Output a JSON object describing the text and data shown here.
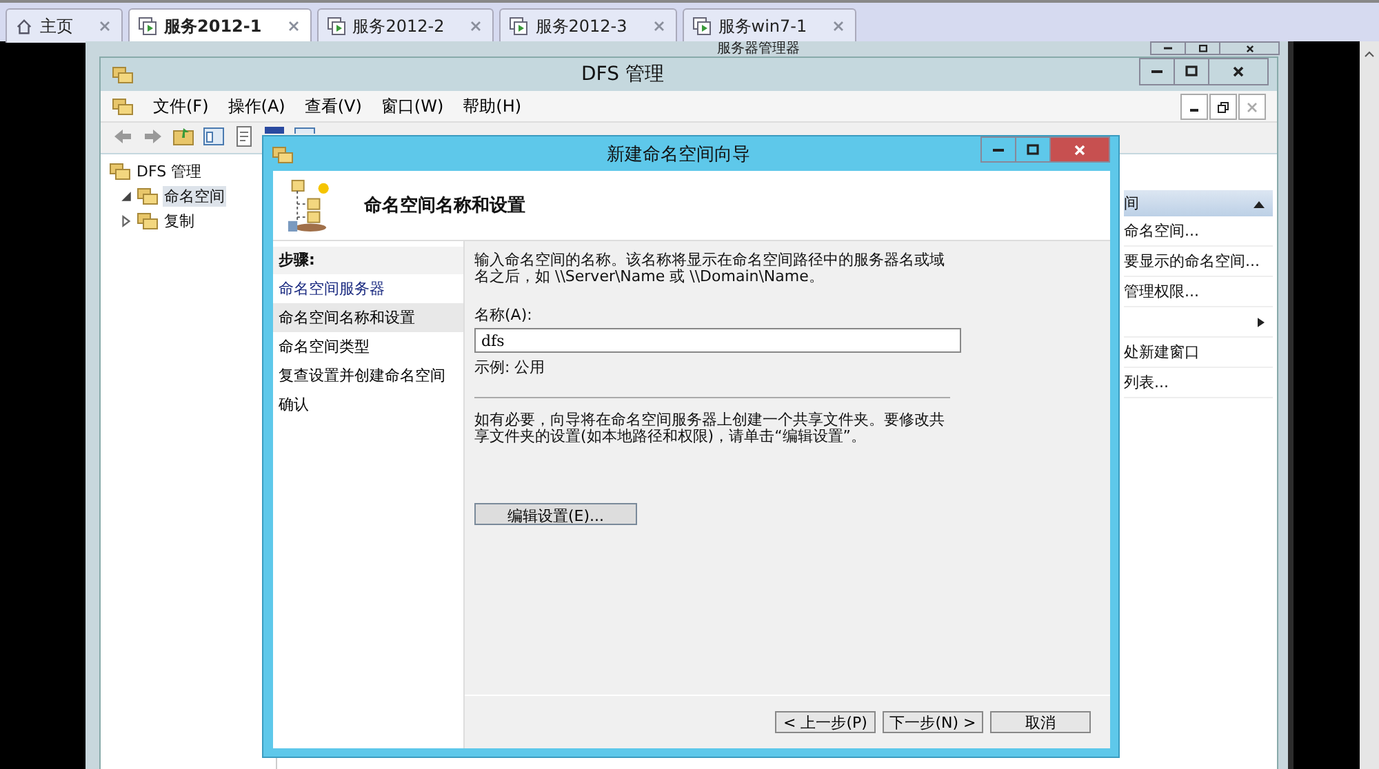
{
  "vm_tabs": [
    {
      "label": "主页",
      "kind": "home",
      "selected": false
    },
    {
      "label": "服务2012-1",
      "kind": "vm",
      "selected": true
    },
    {
      "label": "服务2012-2",
      "kind": "vm",
      "selected": false
    },
    {
      "label": "服务2012-3",
      "kind": "vm",
      "selected": false
    },
    {
      "label": "服务win7-1",
      "kind": "vm",
      "selected": false
    }
  ],
  "server_manager": {
    "title": "服务器管理器"
  },
  "dfs_window": {
    "title": "DFS 管理",
    "menu": [
      "文件(F)",
      "操作(A)",
      "查看(V)",
      "窗口(W)",
      "帮助(H)"
    ],
    "tree": [
      {
        "label": "DFS 管理",
        "children": [
          {
            "label": "命名空间",
            "selected": true,
            "expanded": true
          },
          {
            "label": "复制",
            "selected": false,
            "expanded": false
          }
        ]
      }
    ],
    "actions": {
      "header": "间",
      "items": [
        {
          "kind": "text",
          "label": "命名空间..."
        },
        {
          "kind": "text",
          "label": "要显示的命名空间..."
        },
        {
          "kind": "text",
          "label": "管理权限..."
        },
        {
          "kind": "submenu"
        },
        {
          "kind": "text",
          "label": "处新建窗口"
        },
        {
          "kind": "text",
          "label": "列表..."
        }
      ]
    }
  },
  "wizard": {
    "title": "新建命名空间向导",
    "heading": "命名空间名称和设置",
    "steps_title": "步骤:",
    "steps": [
      {
        "label": "命名空间服务器",
        "selected": false
      },
      {
        "label": "命名空间名称和设置",
        "selected": true
      },
      {
        "label": "命名空间类型",
        "selected": false
      },
      {
        "label": "复查设置并创建命名空间",
        "selected": false
      },
      {
        "label": "确认",
        "selected": false
      }
    ],
    "intro": "输入命名空间的名称。该名称将显示在命名空间路径中的服务器名或域名之后，如 \\\\Server\\Name 或 \\\\Domain\\Name。",
    "name_label": "名称(A):",
    "name_value": "dfs",
    "example": "示例: 公用",
    "note": "如有必要，向导将在命名空间服务器上创建一个共享文件夹。要修改共享文件夹的设置(如本地路径和权限)，请单击“编辑设置”。",
    "edit_button": "编辑设置(E)...",
    "buttons": [
      "< 上一步(P)",
      "下一步(N) >",
      "取消"
    ]
  }
}
